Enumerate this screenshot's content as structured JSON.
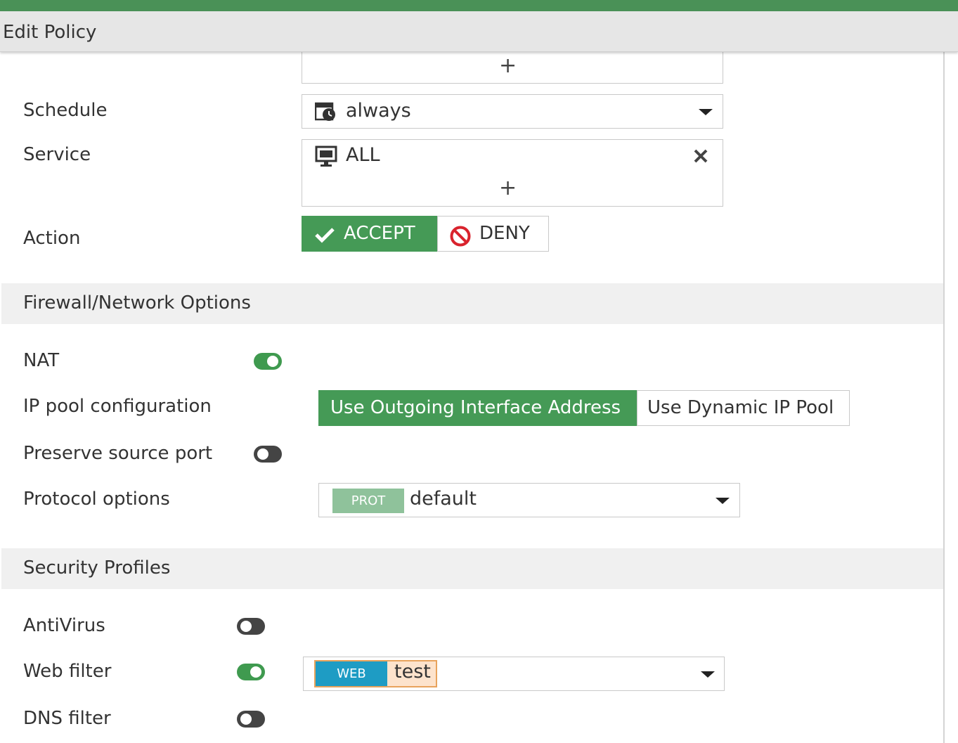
{
  "window": {
    "title": "Edit Policy"
  },
  "colors": {
    "accent_green": "#459a56",
    "deny_red": "#d9232d",
    "web_tag": "#1e9cc4",
    "prot_tag": "#8fc29b",
    "web_value_bg": "#fde3cc"
  },
  "fields": {
    "schedule": {
      "label": "Schedule",
      "value": "always",
      "icon": "schedule-clock-icon"
    },
    "service": {
      "label": "Service",
      "value": "ALL",
      "icon": "service-monitor-icon"
    },
    "action": {
      "label": "Action",
      "accept_label": "ACCEPT",
      "deny_label": "DENY",
      "selected": "ACCEPT"
    }
  },
  "firewall": {
    "title": "Firewall/Network Options",
    "nat": {
      "label": "NAT",
      "enabled": true
    },
    "ip_pool": {
      "label": "IP pool configuration",
      "option_outgoing": "Use Outgoing Interface Address",
      "option_dynamic": "Use Dynamic IP Pool",
      "selected": "Use Outgoing Interface Address"
    },
    "preserve_port": {
      "label": "Preserve source port",
      "enabled": false
    },
    "protocol": {
      "label": "Protocol options",
      "tag": "PROT",
      "value": "default"
    }
  },
  "security": {
    "title": "Security Profiles",
    "antivirus": {
      "label": "AntiVirus",
      "enabled": false
    },
    "webfilter": {
      "label": "Web filter",
      "enabled": true,
      "tag": "WEB",
      "value": "test"
    },
    "dnsfilter": {
      "label": "DNS filter",
      "enabled": false
    }
  }
}
